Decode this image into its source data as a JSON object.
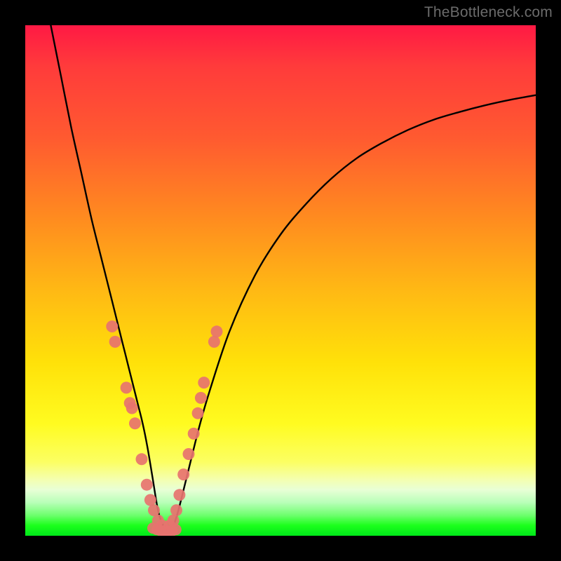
{
  "watermark": "TheBottleneck.com",
  "chart_data": {
    "type": "line",
    "title": "",
    "xlabel": "",
    "ylabel": "",
    "xlim": [
      0,
      100
    ],
    "ylim": [
      0,
      100
    ],
    "grid": false,
    "legend": false,
    "series": [
      {
        "name": "bottleneck-curve",
        "color": "#000000",
        "x": [
          5,
          7,
          9,
          11,
          13,
          15,
          17,
          19,
          20,
          21,
          22,
          23,
          24,
          25,
          26,
          27,
          28,
          29,
          30,
          32,
          34,
          36,
          40,
          45,
          50,
          55,
          60,
          65,
          70,
          75,
          80,
          85,
          90,
          95,
          100
        ],
        "values": [
          100,
          90,
          80,
          71,
          62,
          54,
          46,
          38,
          34,
          30,
          26,
          22,
          17,
          11,
          5,
          2,
          1,
          2,
          5,
          13,
          21,
          28,
          40,
          51,
          59,
          65,
          70,
          74,
          77,
          79.5,
          81.5,
          83,
          84.3,
          85.4,
          86.3
        ]
      }
    ],
    "scatter_overlay": {
      "name": "data-points",
      "color": "#e7736f",
      "points": [
        {
          "x": 17.0,
          "y": 41
        },
        {
          "x": 17.6,
          "y": 38
        },
        {
          "x": 19.8,
          "y": 29
        },
        {
          "x": 20.5,
          "y": 26
        },
        {
          "x": 20.9,
          "y": 25
        },
        {
          "x": 21.5,
          "y": 22
        },
        {
          "x": 22.8,
          "y": 15
        },
        {
          "x": 23.8,
          "y": 10
        },
        {
          "x": 24.5,
          "y": 7
        },
        {
          "x": 25.2,
          "y": 5
        },
        {
          "x": 26.0,
          "y": 3
        },
        {
          "x": 26.8,
          "y": 2
        },
        {
          "x": 27.5,
          "y": 1
        },
        {
          "x": 28.3,
          "y": 2
        },
        {
          "x": 29.0,
          "y": 3
        },
        {
          "x": 29.6,
          "y": 5
        },
        {
          "x": 30.2,
          "y": 8
        },
        {
          "x": 31.0,
          "y": 12
        },
        {
          "x": 32.0,
          "y": 16
        },
        {
          "x": 33.0,
          "y": 20
        },
        {
          "x": 33.8,
          "y": 24
        },
        {
          "x": 34.4,
          "y": 27
        },
        {
          "x": 35.0,
          "y": 30
        },
        {
          "x": 37.0,
          "y": 38
        },
        {
          "x": 37.5,
          "y": 40
        }
      ]
    },
    "bottom_cluster": {
      "name": "valley-band",
      "color": "#e7736f",
      "points": [
        {
          "x": 25.0,
          "y": 1.5
        },
        {
          "x": 25.8,
          "y": 1.2
        },
        {
          "x": 26.5,
          "y": 1.0
        },
        {
          "x": 27.2,
          "y": 0.9
        },
        {
          "x": 28.0,
          "y": 0.9
        },
        {
          "x": 28.8,
          "y": 1.0
        },
        {
          "x": 29.5,
          "y": 1.2
        }
      ]
    }
  }
}
